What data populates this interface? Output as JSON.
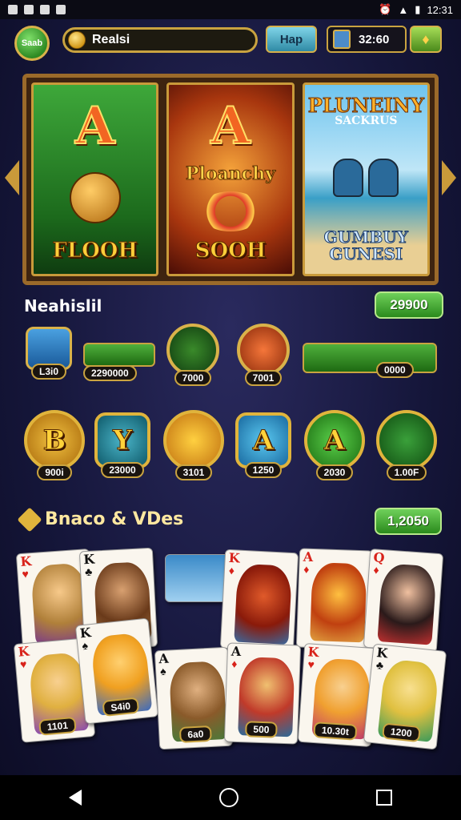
{
  "status": {
    "time": "12:31"
  },
  "top": {
    "left_btn": "Saab",
    "search_text": "Realsi",
    "play_btn": "Hap",
    "timer": "32:60"
  },
  "banner": {
    "p1": {
      "letter": "A",
      "caption": "FLOOH"
    },
    "p2": {
      "letter": "A",
      "mid": "Ploanchy",
      "caption": "SOOH"
    },
    "p3": {
      "title": "PLUNEINY",
      "subtitle": "SACKRUS",
      "bottom": "GUMBUY GUNESI"
    }
  },
  "section1": {
    "title": "Neahislil",
    "value": "29900"
  },
  "row1": [
    "L3i0",
    "2290000",
    "7000",
    "7001",
    "0000"
  ],
  "row2": [
    {
      "glyph": "B",
      "label": "900i"
    },
    {
      "glyph": "Y",
      "label": "23000"
    },
    {
      "glyph": "",
      "label": "3101"
    },
    {
      "glyph": "A",
      "label": "1250"
    },
    {
      "glyph": "A",
      "label": "2030"
    },
    {
      "glyph": "",
      "label": "1.00F"
    }
  ],
  "section2": {
    "title": "Bnaco & VDes",
    "value": "1,2050"
  },
  "cards": [
    {
      "rank": "K",
      "suit": "♥",
      "label": ""
    },
    {
      "rank": "K",
      "suit": "♣",
      "label": ""
    },
    {
      "rank": "",
      "suit": "",
      "label": ""
    },
    {
      "rank": "K",
      "suit": "♦",
      "label": ""
    },
    {
      "rank": "A",
      "suit": "♦",
      "label": ""
    },
    {
      "rank": "Q",
      "suit": "♦",
      "label": ""
    },
    {
      "rank": "K",
      "suit": "♥",
      "label": "1101"
    },
    {
      "rank": "K",
      "suit": "♠",
      "label": "S4i0"
    },
    {
      "rank": "A",
      "suit": "♠",
      "label": "6a0"
    },
    {
      "rank": "A",
      "suit": "♦",
      "label": "500"
    },
    {
      "rank": "K",
      "suit": "♥",
      "label": "10.30t"
    },
    {
      "rank": "K",
      "suit": "♣",
      "label": "1200"
    }
  ],
  "colors": {
    "accent_gold": "#c9a340",
    "green": "#2a8a1c",
    "bg": "#15163a"
  }
}
